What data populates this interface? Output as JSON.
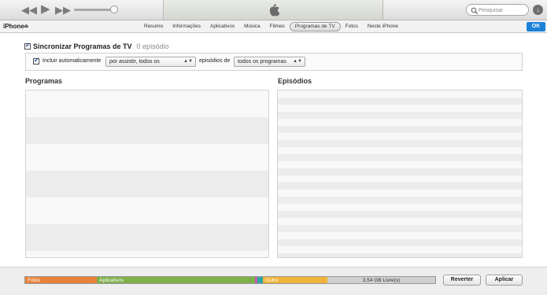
{
  "player": {
    "icons": [
      "rewind-icon",
      "play-icon",
      "fast-forward-icon",
      "apple-logo",
      "search-icon",
      "download-icon"
    ],
    "search": {
      "placeholder": "Pesquisar"
    }
  },
  "device": {
    "name": "iPhone"
  },
  "tabs": [
    {
      "label": "Resumo",
      "active": false
    },
    {
      "label": "Informações",
      "active": false
    },
    {
      "label": "Aplicativos",
      "active": false
    },
    {
      "label": "Música",
      "active": false
    },
    {
      "label": "Filmes",
      "active": false
    },
    {
      "label": "Programas de TV",
      "active": true
    },
    {
      "label": "Fotos",
      "active": false
    },
    {
      "label": "Neste iPhone",
      "active": false
    }
  ],
  "ok_label": "OK",
  "sync": {
    "checked": true,
    "label": "Sincronizar Programas de TV",
    "count": "0 episódio"
  },
  "options": {
    "include_checked": true,
    "include_label": "Incluir automaticamente",
    "filter_value": "por assistir, todos os",
    "episodes_label": "episódios de",
    "source_value": "todos os programas"
  },
  "panels": {
    "programs_title": "Programas",
    "episodes_title": "Episódios"
  },
  "storage": {
    "segments": [
      {
        "label": "Fotos",
        "color": "#e8823a",
        "fraction": 0.175
      },
      {
        "label": "Aplicativos",
        "color": "#7fb04a",
        "fraction": 0.385
      },
      {
        "label": "",
        "color": "#c85aa8",
        "fraction": 0.006
      },
      {
        "label": "",
        "color": "#2fa6a6",
        "fraction": 0.014
      },
      {
        "label": "Outro",
        "color": "#f0b43a",
        "fraction": 0.157
      }
    ],
    "free_label": "3,54 GB Livre(s)",
    "free_color": "#cfcfcf"
  },
  "buttons": {
    "revert": "Reverter",
    "apply": "Aplicar"
  }
}
